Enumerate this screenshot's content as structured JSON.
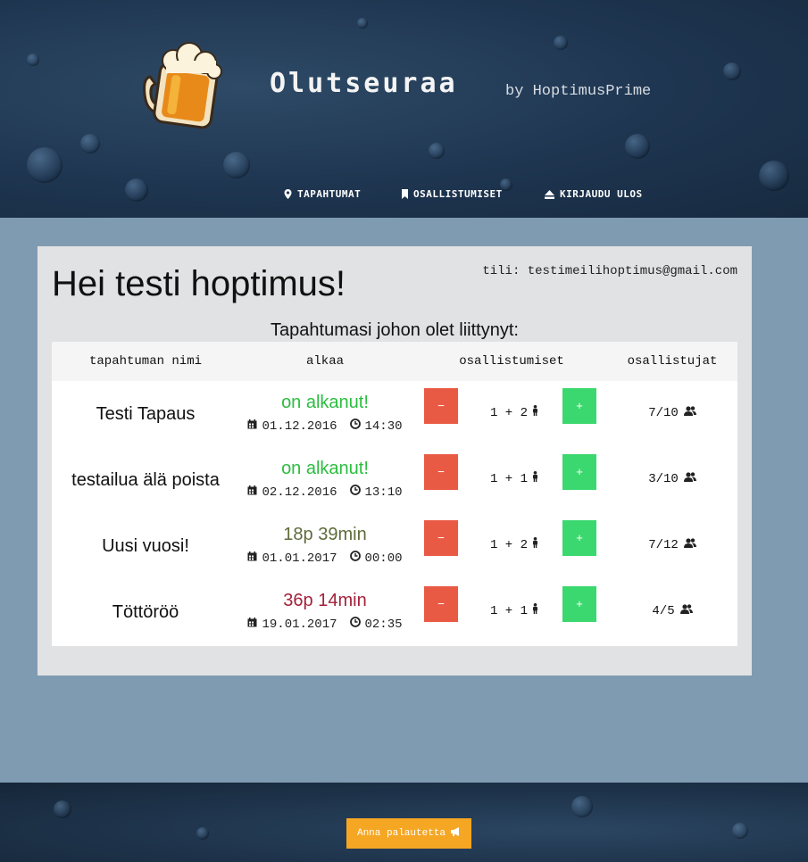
{
  "header": {
    "brand": "Olutseuraa",
    "byline": "by HoptimusPrime",
    "nav": [
      {
        "label": "TAPAHTUMAT",
        "icon": "map-marker-icon"
      },
      {
        "label": "OSALLISTUMISET",
        "icon": "bookmark-icon"
      },
      {
        "label": "KIRJAUDU ULOS",
        "icon": "eject-icon"
      }
    ]
  },
  "main": {
    "greeting": "Hei testi hoptimus!",
    "account": "tili: testimeilihoptimus@gmail.com",
    "subtitle": "Tapahtumasi johon olet liittynyt:",
    "columns": [
      "tapahtuman nimi",
      "alkaa",
      "osallistumiset",
      "osallistujat"
    ],
    "minus_label": "−",
    "plus_label": "+",
    "events": [
      {
        "name": "Testi Tapaus",
        "status": "on alkanut!",
        "status_color": "#2bbd3f",
        "date": "01.12.2016",
        "time": "14:30",
        "count": "1 + 2",
        "attendees": "7/10"
      },
      {
        "name": "testailua älä poista",
        "status": "on alkanut!",
        "status_color": "#2bbd3f",
        "date": "02.12.2016",
        "time": "13:10",
        "count": "1 + 1",
        "attendees": "3/10"
      },
      {
        "name": "Uusi vuosi!",
        "status": "18p 39min",
        "status_color": "#5f6a3a",
        "date": "01.01.2017",
        "time": "00:00",
        "count": "1 + 2",
        "attendees": "7/12"
      },
      {
        "name": "Töttöröö",
        "status": "36p 14min",
        "status_color": "#a3213a",
        "date": "19.01.2017",
        "time": "02:35",
        "count": "1 + 1",
        "attendees": "4/5"
      }
    ]
  },
  "footer": {
    "feedback_label": "Anna palautetta",
    "feedback_icon": "megaphone-icon"
  }
}
